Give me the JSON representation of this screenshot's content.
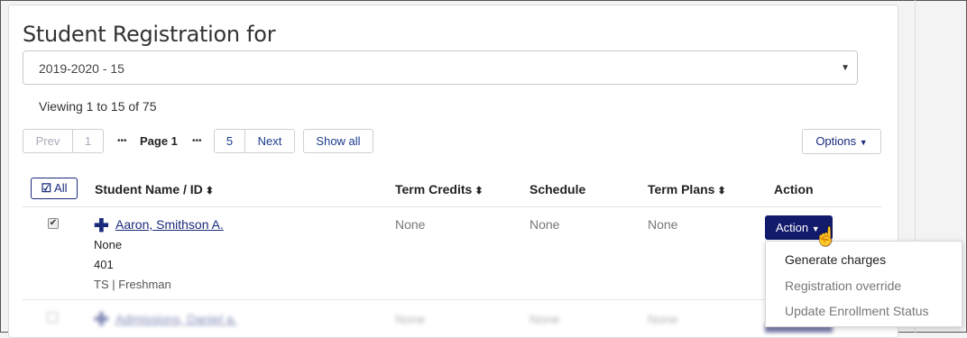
{
  "page": {
    "title": "Student Registration for",
    "term_select": {
      "value": "2019-2020 - 15"
    },
    "viewing": "Viewing 1 to 15 of 75"
  },
  "pager": {
    "prev": "Prev",
    "first": "1",
    "ellipsis": "•••",
    "current": "Page 1",
    "last": "5",
    "next": "Next",
    "show_all": "Show all"
  },
  "options_label": "Options",
  "table": {
    "select_all": "All",
    "headers": [
      "Student Name / ID",
      "Term Credits",
      "Schedule",
      "Term Plans",
      "Action"
    ],
    "rows": [
      {
        "name": "Aaron, Smithson A.",
        "sub1": "None",
        "sub2": "401",
        "sub3": "TS | Freshman",
        "credits": "None",
        "schedule": "None",
        "plans": "None",
        "action": "Action"
      },
      {
        "name": "Admissions, Daniel a.",
        "credits": "None",
        "schedule": "None",
        "plans": "None"
      }
    ]
  },
  "action_menu": [
    "Generate charges",
    "Registration override",
    "Update Enrollment Status"
  ],
  "colors": {
    "primary": "#121a6b",
    "link": "#1a2a7a"
  }
}
